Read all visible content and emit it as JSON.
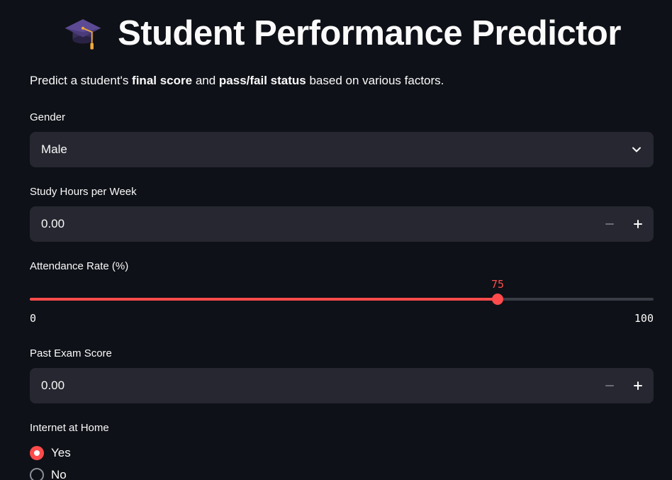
{
  "app": {
    "title": "Student Performance Predictor",
    "title_icon": "graduation-cap-icon"
  },
  "intro": {
    "prefix": "Predict a student's ",
    "bold1": "final score",
    "middle": " and ",
    "bold2": "pass/fail status",
    "suffix": " based on various factors."
  },
  "gender": {
    "label": "Gender",
    "selected": "Male",
    "icon": "chevron-down-icon"
  },
  "study_hours": {
    "label": "Study Hours per Week",
    "value": "0.00",
    "minus_icon": "minus-icon",
    "plus_icon": "plus-icon"
  },
  "attendance": {
    "label": "Attendance Rate (%)",
    "value": 75,
    "value_text": "75",
    "min": 0,
    "max": 100,
    "min_text": "0",
    "max_text": "100"
  },
  "past_exam": {
    "label": "Past Exam Score",
    "value": "0.00",
    "minus_icon": "minus-icon",
    "plus_icon": "plus-icon"
  },
  "internet": {
    "label": "Internet at Home",
    "options": [
      {
        "label": "Yes",
        "selected": true
      },
      {
        "label": "No",
        "selected": false
      }
    ]
  },
  "colors": {
    "background": "#0e1117",
    "widget": "#262730",
    "accent": "#ff4b4b",
    "text": "#fafafa",
    "muted": "#8b8d98"
  }
}
